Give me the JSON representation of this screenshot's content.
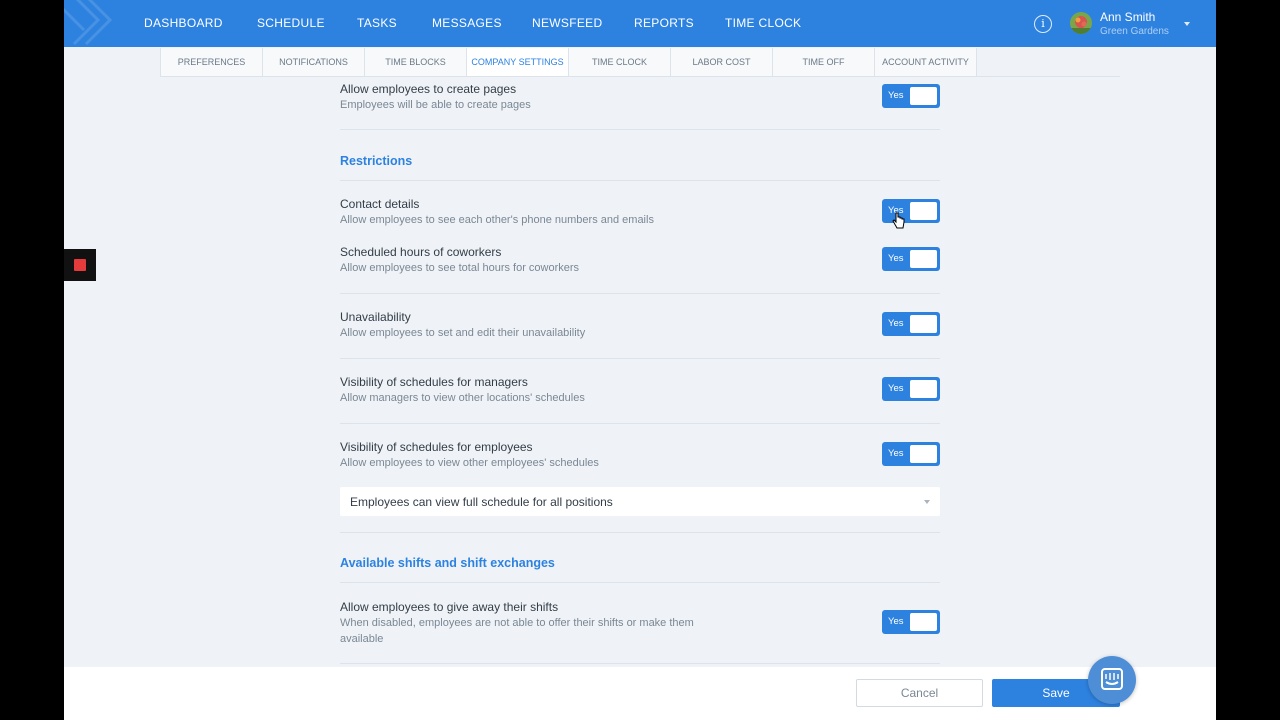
{
  "nav": {
    "items": [
      "DASHBOARD",
      "SCHEDULE",
      "TASKS",
      "MESSAGES",
      "NEWSFEED",
      "REPORTS",
      "TIME CLOCK"
    ],
    "info_icon": "info-icon",
    "user": {
      "name": "Ann Smith",
      "company": "Green Gardens"
    }
  },
  "subtabs": {
    "items": [
      "PREFERENCES",
      "NOTIFICATIONS",
      "TIME BLOCKS",
      "COMPANY SETTINGS",
      "TIME CLOCK",
      "LABOR COST",
      "TIME OFF",
      "ACCOUNT ACTIVITY"
    ],
    "active": "COMPANY SETTINGS"
  },
  "settings": {
    "create_pages": {
      "title": "Allow employees to create pages",
      "desc": "Employees will be able to create pages",
      "toggle": "Yes",
      "on": true
    },
    "restrictions": {
      "heading": "Restrictions",
      "contact_details": {
        "title": "Contact details",
        "desc": "Allow employees to see each other's phone numbers and emails",
        "toggle": "Yes",
        "on": true
      },
      "scheduled_hours": {
        "title": "Scheduled hours of coworkers",
        "desc": "Allow employees to see total hours for coworkers",
        "toggle": "Yes",
        "on": true
      },
      "unavailability": {
        "title": "Unavailability",
        "desc": "Allow employees to set and edit their unavailability",
        "toggle": "Yes",
        "on": true
      },
      "vis_managers": {
        "title": "Visibility of schedules for managers",
        "desc": "Allow managers to view other locations' schedules",
        "toggle": "Yes",
        "on": true
      },
      "vis_employees": {
        "title": "Visibility of schedules for employees",
        "desc": "Allow employees to view other employees' schedules",
        "toggle": "Yes",
        "on": true
      },
      "schedule_select": "Employees can view full schedule for all positions"
    },
    "shifts": {
      "heading": "Available shifts and shift exchanges",
      "give_away": {
        "title": "Allow employees to give away their shifts",
        "desc_line1": "When disabled, employees are not able to offer their shifts or make them",
        "desc_line2": "available",
        "toggle": "Yes",
        "on": true
      }
    }
  },
  "footer": {
    "cancel": "Cancel",
    "save": "Save"
  },
  "colors": {
    "primary": "#2d82e0",
    "background": "#eff3f7",
    "record": "#e53b3b"
  }
}
